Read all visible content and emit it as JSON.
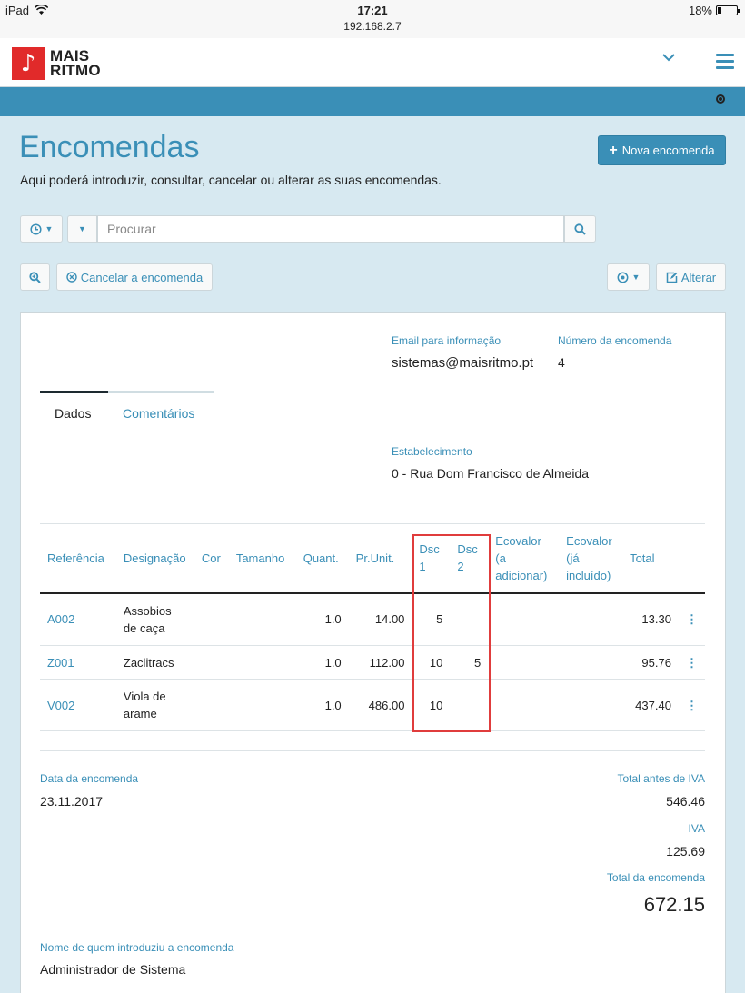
{
  "statusbar": {
    "device": "iPad",
    "time": "17:21",
    "url": "192.168.2.7",
    "battery": "18%"
  },
  "header": {
    "logo_line1": "MAIS",
    "logo_line2": "RITMO"
  },
  "page": {
    "title": "Encomendas",
    "description": "Aqui poderá introduzir, consultar, cancelar ou alterar as suas encomendas.",
    "new_button": "Nova encomenda"
  },
  "search": {
    "placeholder": "Procurar"
  },
  "toolbar": {
    "cancel_label": "Cancelar a encomenda",
    "edit_label": "Alterar"
  },
  "order": {
    "email_label": "Email para informação",
    "email_value": "sistemas@maisritmo.pt",
    "number_label": "Número da encomenda",
    "number_value": "4",
    "tabs": [
      "Dados",
      "Comentários"
    ],
    "establishment_label": "Estabelecimento",
    "establishment_value": "0 - Rua Dom Francisco de Almeida"
  },
  "table": {
    "columns": [
      "Referência",
      "Designação",
      "Cor",
      "Tamanho",
      "Quant.",
      "Pr.Unit.",
      "Dsc 1",
      "Dsc 2",
      "Ecovalor (a adicionar)",
      "Ecovalor (já incluído)",
      "Total"
    ],
    "rows": [
      {
        "ref": "A002",
        "designation": "Assobios de caça",
        "color": "",
        "size": "",
        "qty": "1.0",
        "price": "14.00",
        "dsc1": "5",
        "dsc2": "",
        "eco_add": "",
        "eco_incl": "",
        "total": "13.30"
      },
      {
        "ref": "Z001",
        "designation": "Zaclitracs",
        "color": "",
        "size": "",
        "qty": "1.0",
        "price": "112.00",
        "dsc1": "10",
        "dsc2": "5",
        "eco_add": "",
        "eco_incl": "",
        "total": "95.76"
      },
      {
        "ref": "V002",
        "designation": "Viola de arame",
        "color": "",
        "size": "",
        "qty": "1.0",
        "price": "486.00",
        "dsc1": "10",
        "dsc2": "",
        "eco_add": "",
        "eco_incl": "",
        "total": "437.40"
      }
    ]
  },
  "summary": {
    "date_label": "Data da encomenda",
    "date_value": "23.11.2017",
    "subtotal_label": "Total antes de IVA",
    "subtotal_value": "546.46",
    "vat_label": "IVA",
    "vat_value": "125.69",
    "total_label": "Total da encomenda",
    "total_value": "672.15",
    "author_label": "Nome de quem introduziu a encomenda",
    "author_value": "Administrador de Sistema"
  },
  "colors": {
    "accent": "#3a8fb7",
    "logo_red": "#e12a2a",
    "highlight": "#e03c3c",
    "background": "#d7e9f1"
  }
}
